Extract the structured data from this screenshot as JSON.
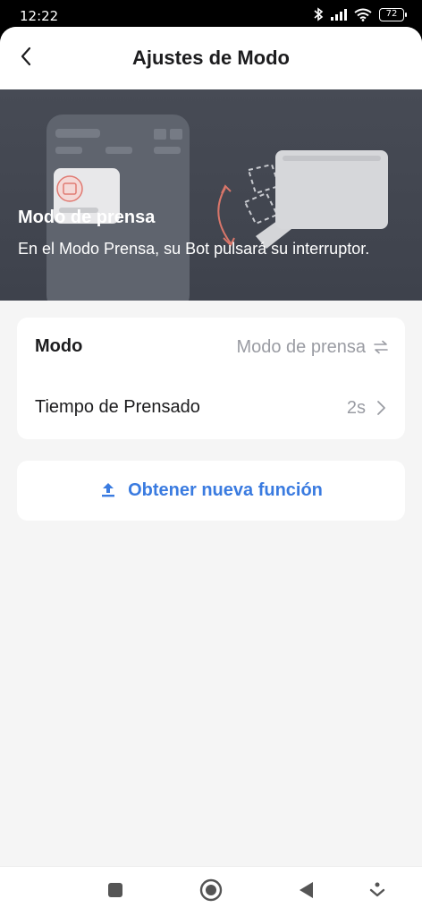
{
  "status_bar": {
    "time": "12:22",
    "battery": "72",
    "icons": [
      "bluetooth-icon",
      "signal-icon",
      "wifi-icon",
      "battery-icon"
    ]
  },
  "header": {
    "title": "Ajustes de Modo",
    "back_icon": "chevron-left-icon"
  },
  "hero": {
    "title": "Modo de prensa",
    "description": "En el Modo Prensa, su Bot pulsará su interruptor."
  },
  "settings": {
    "mode": {
      "label": "Modo",
      "value": "Modo de prensa",
      "icon": "swap-icon"
    },
    "press_time": {
      "label": "Tiempo de Prensado",
      "value": "2s",
      "icon": "chevron-right-icon"
    }
  },
  "feature": {
    "label": "Obtener nueva función",
    "icon": "upload-icon"
  },
  "nav_bar": {
    "icons": [
      "square-icon",
      "home-circle-icon",
      "back-triangle-icon",
      "down-menu-icon"
    ]
  },
  "colors": {
    "accent": "#3a7be0",
    "hero_bg": "#434750",
    "page_bg": "#f5f5f5",
    "secondary_text": "#9a9ca3"
  }
}
